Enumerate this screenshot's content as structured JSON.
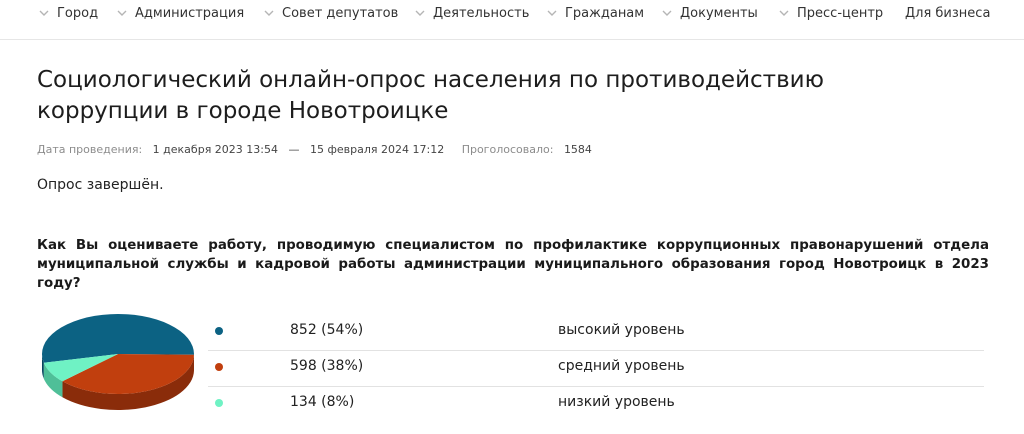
{
  "nav": {
    "items": [
      {
        "label": "Город",
        "has_dropdown": true
      },
      {
        "label": "Администрация",
        "has_dropdown": true
      },
      {
        "label": "Совет депутатов",
        "has_dropdown": true
      },
      {
        "label": "Деятельность",
        "has_dropdown": true
      },
      {
        "label": "Гражданам",
        "has_dropdown": true
      },
      {
        "label": "Документы",
        "has_dropdown": true
      },
      {
        "label": "Пресс-центр",
        "has_dropdown": true
      },
      {
        "label": "Для бизнеса",
        "has_dropdown": false
      }
    ]
  },
  "poll": {
    "title": "Социологический онлайн-опрос населения по противодействию коррупции в городе Новотроицке",
    "date_label": "Дата проведения:",
    "date_start": "1 декабря 2023 13:54",
    "date_separator": "—",
    "date_end": "15 февраля 2024 17:12",
    "votes_label": "Проголосовало:",
    "votes_count": "1584",
    "status": "Опрос завершён.",
    "question": "Как Вы оцениваете работу, проводимую специалистом по профилактике коррупционных правонарушений отдела муниципальной службы и кадровой работы администрации муниципального образования город Новотроицк в 2023 году?"
  },
  "chart_data": {
    "type": "pie",
    "categories": [
      "высокий уровень",
      "средний уровень",
      "низкий уровень"
    ],
    "values": [
      852,
      598,
      134
    ],
    "percents": [
      54,
      38,
      8
    ],
    "value_labels": [
      "852 (54%)",
      "598 (38%)",
      "134 (8%)"
    ],
    "colors": [
      "#0c6283",
      "#c13f0e",
      "#6ff2c4"
    ],
    "side_colors": [
      "#07455e",
      "#8a2c0a",
      "#4fbf98"
    ],
    "style": "3d"
  }
}
